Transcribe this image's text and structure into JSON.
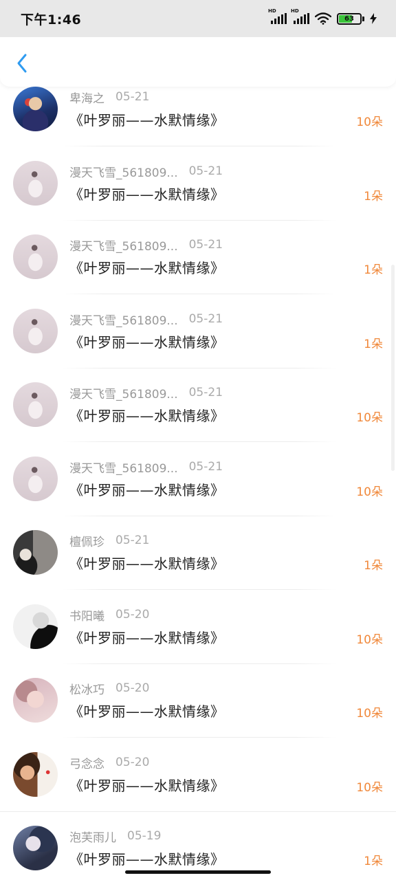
{
  "status_bar": {
    "time": "下午1:46",
    "signal_labels": [
      "HD",
      "HD"
    ],
    "battery_level": "63",
    "icons": [
      "signal-icon",
      "signal-icon",
      "wifi-icon",
      "battery-icon",
      "charging-icon"
    ]
  },
  "nav": {
    "back_icon": "chevron-left-icon"
  },
  "colors": {
    "accent": "#2f9bf0",
    "count": "#f0883a",
    "name": "#999999",
    "gift": "#222222"
  },
  "list": [
    {
      "name": "卑海之",
      "date": "05-21",
      "gift": "《叶罗丽——水默情缘》",
      "count": "10朵"
    },
    {
      "name": "漫天飞雪_561809...",
      "date": "05-21",
      "gift": "《叶罗丽——水默情缘》",
      "count": "1朵"
    },
    {
      "name": "漫天飞雪_561809...",
      "date": "05-21",
      "gift": "《叶罗丽——水默情缘》",
      "count": "1朵"
    },
    {
      "name": "漫天飞雪_561809...",
      "date": "05-21",
      "gift": "《叶罗丽——水默情缘》",
      "count": "1朵"
    },
    {
      "name": "漫天飞雪_561809...",
      "date": "05-21",
      "gift": "《叶罗丽——水默情缘》",
      "count": "10朵"
    },
    {
      "name": "漫天飞雪_561809...",
      "date": "05-21",
      "gift": "《叶罗丽——水默情缘》",
      "count": "10朵"
    },
    {
      "name": "檀佩珍",
      "date": "05-21",
      "gift": "《叶罗丽——水默情缘》",
      "count": "1朵"
    },
    {
      "name": "书阳曦",
      "date": "05-20",
      "gift": "《叶罗丽——水默情缘》",
      "count": "10朵"
    },
    {
      "name": "松冰巧",
      "date": "05-20",
      "gift": "《叶罗丽——水默情缘》",
      "count": "10朵"
    },
    {
      "name": "弓念念",
      "date": "05-20",
      "gift": "《叶罗丽——水默情缘》",
      "count": "10朵"
    },
    {
      "name": "泡芙雨儿",
      "date": "05-19",
      "gift": "《叶罗丽——水默情缘》",
      "count": "1朵"
    }
  ]
}
